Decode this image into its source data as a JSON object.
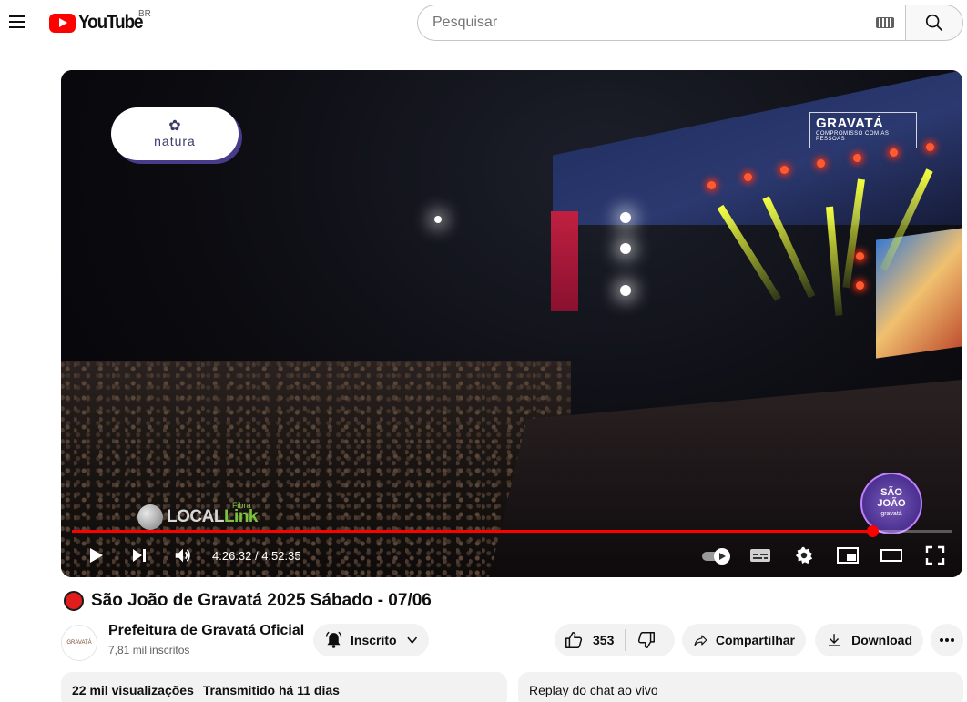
{
  "header": {
    "logo_text": "YouTube",
    "country_code": "BR",
    "search_placeholder": "Pesquisar",
    "icons": [
      "menu-icon",
      "keyboard-icon",
      "search-icon"
    ]
  },
  "player": {
    "overlay_brands": {
      "natura": "natura",
      "gravata_title": "GRAVATÁ",
      "gravata_sub": "COMPROMISSO COM AS PESSOAS",
      "local_link": "LOCAL",
      "local_link_suffix": "Link",
      "local_fibra": "Fibra",
      "sao_joao_1": "SÃO",
      "sao_joao_2": "JOÃO",
      "sao_joao_3": "gravatá"
    },
    "time_display": "4:26:32 / 4:52:35",
    "progress_fraction": 0.91,
    "accent_color": "#ff0000",
    "controls": [
      "play-icon",
      "next-icon",
      "volume-icon",
      "autoplay-toggle",
      "subtitles-icon",
      "settings-icon",
      "miniplayer-icon",
      "theater-icon",
      "fullscreen-icon"
    ]
  },
  "video": {
    "live_indicator_color": "#e01c1c",
    "title": "São João de Gravatá 2025 Sábado - 07/06",
    "channel_name": "Prefeitura de Gravatá Oficial",
    "channel_avatar_text": "GRAVATÁ",
    "subscribers": "7,81 mil inscritos",
    "subscribe_label": "Inscrito",
    "like_count": "353",
    "share_label": "Compartilhar",
    "download_label": "Download"
  },
  "description": {
    "views": "22 mil visualizações",
    "streamed": "Transmitido há 11 dias",
    "chat_replay": "Replay do chat ao vivo"
  }
}
